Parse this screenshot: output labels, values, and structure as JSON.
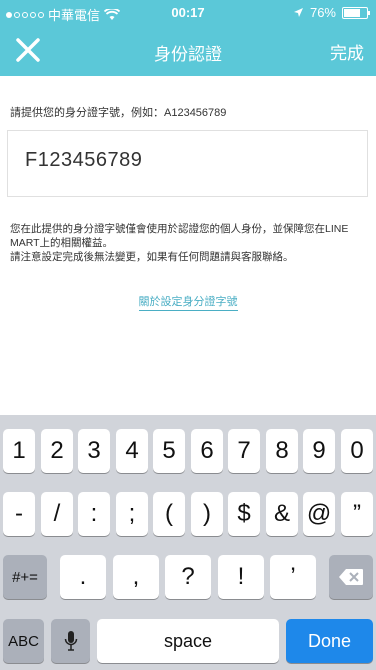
{
  "status_bar": {
    "carrier": "中華電信",
    "time": "00:17",
    "battery": "76%"
  },
  "nav": {
    "title": "身份認證",
    "done_label": "完成"
  },
  "form": {
    "prompt": "請提供您的身分證字號，例如：A123456789",
    "id_value": "F123456789"
  },
  "notes": {
    "line1": "您在此提供的身分證字號僅會使用於認證您的個人身份，並保障您在LINE MART上的相關權益。",
    "line2": "請注意設定完成後無法變更，如果有任何問題請與客服聯絡。"
  },
  "link_label": "關於設定身分證字號",
  "keyboard": {
    "row1": [
      "1",
      "2",
      "3",
      "4",
      "5",
      "6",
      "7",
      "8",
      "9",
      "0"
    ],
    "row2": [
      "-",
      "/",
      ":",
      ";",
      "(",
      ")",
      "$",
      "&",
      "@",
      "”"
    ],
    "row3_left": "#+=",
    "row3": [
      ".",
      ",",
      "?",
      "!",
      "’"
    ],
    "abc": "ABC",
    "space": "space",
    "done": "Done"
  }
}
